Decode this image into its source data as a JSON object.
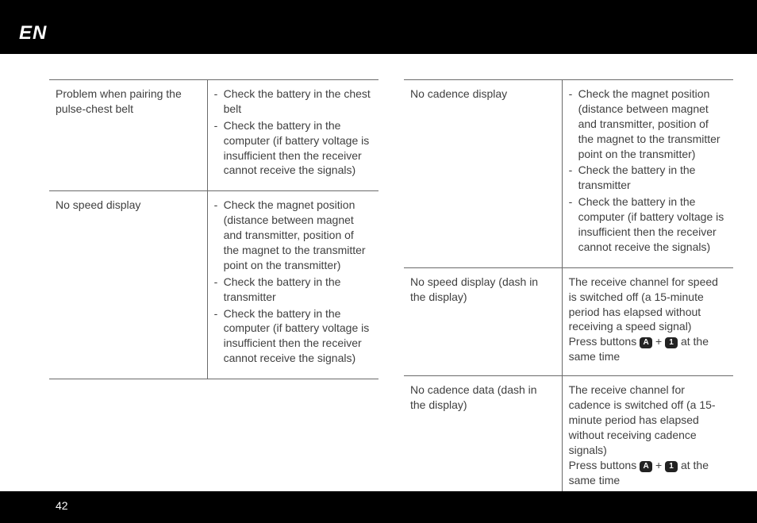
{
  "header": {
    "lang": "EN"
  },
  "footer": {
    "page": "42"
  },
  "left_table": [
    {
      "problem": "Problem when pairing the pulse-chest belt",
      "solutions": [
        "Check the battery in the chest belt",
        "Check the battery in the computer (if battery voltage is insufficient then the receiver cannot receive the signals)"
      ],
      "plain": null
    },
    {
      "problem": "No speed display",
      "solutions": [
        "Check the magnet position (distance between magnet and transmitter, position of the magnet to the transmitter point on the transmitter)",
        "Check the battery in the transmitter",
        "Check the battery in the computer (if battery voltage is insufficient then the receiver cannot receive the signals)"
      ],
      "plain": null
    }
  ],
  "right_table": [
    {
      "problem": "No cadence display",
      "solutions": [
        "Check the magnet position (distance between magnet and transmitter, position of the magnet to the transmitter point on the transmitter)",
        "Check the battery in the transmitter",
        "Check the battery in the computer (if battery voltage is insufficient then the receiver cannot receive the signals)"
      ],
      "plain": null
    },
    {
      "problem": "No speed display (dash in the display)",
      "solutions": [],
      "plain": {
        "text_before": "The receive channel for speed is switched off (a 15-minute period has elapsed without receiving a speed signal)",
        "press_label": "Press buttons ",
        "btn_a": "A",
        "plus": " + ",
        "btn_1": "1",
        "after": " at the same time"
      }
    },
    {
      "problem": "No cadence data (dash in the display)",
      "solutions": [],
      "plain": {
        "text_before": "The receive channel for cadence is switched off (a 15-minute period has elapsed without receiving cadence signals)",
        "press_label": "Press buttons ",
        "btn_a": "A",
        "plus": " + ",
        "btn_1": "1",
        "after": " at the same time"
      }
    }
  ]
}
